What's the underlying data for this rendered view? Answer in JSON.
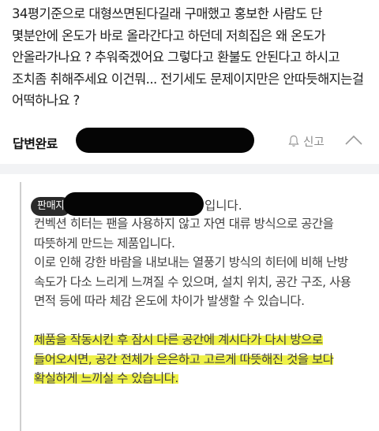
{
  "question": {
    "text": "34평기준으로 대형쓰면된다길래 구매했고 홍보한 사람도 단 몇분안에 온도가 바로 올라간다고 하던데 저희집은 왜 온도가 안올라가나요 ? 추워죽겠어요 그렇다고 환불도 안된다고 하시고 조치좀 취해주세요 이건뭐... 전기세도 문제이지만은 안따듯해지는걸 어떡하나요 ?"
  },
  "status": {
    "label": "답변완료",
    "report_label": "신고",
    "report_icon": "bell-icon",
    "collapse_icon": "chevron-up-icon"
  },
  "answer": {
    "badge": "판매자",
    "intro_end": "입니다.",
    "paragraph1": "컨벡션 히터는 팬을 사용하지 않고 자연 대류 방식으로 공간을 따뜻하게 만드는 제품입니다.",
    "paragraph2": "이로 인해 강한 바람을 내보내는 열풍기 방식의 히터에 비해 난방 속도가 다소 느리게 느껴질 수 있으며, 설치 위치, 공간 구조, 사용 면적 등에 따라 체감 온도에 차이가 발생할 수 있습니다.",
    "paragraph3": "제품을 작동시킨 후 잠시 다른 공간에 계시다가 다시 방으로 들어오시면, 공간 전체가 은은하고 고르게 따뜻해진 것을 보다 확실하게 느끼실 수 있습니다.",
    "highlight_color": "#eff24a"
  }
}
